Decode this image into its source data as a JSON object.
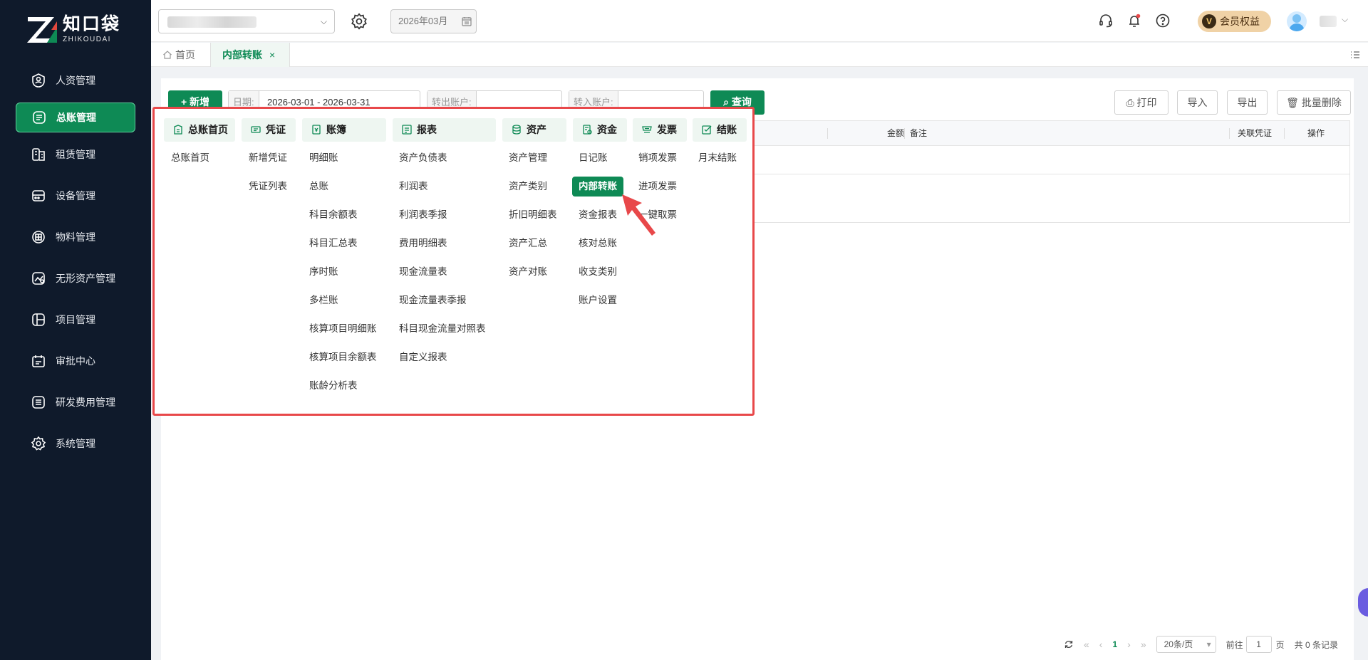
{
  "brand": {
    "name_cn": "知口袋",
    "name_en": "ZHIKOUDAI",
    "accent": "#0e8a55"
  },
  "sidebar": {
    "items": [
      {
        "label": "人资管理",
        "icon": "user-badge-icon"
      },
      {
        "label": "总账管理",
        "icon": "ledger-icon",
        "active": true
      },
      {
        "label": "租赁管理",
        "icon": "lease-icon"
      },
      {
        "label": "设备管理",
        "icon": "device-icon"
      },
      {
        "label": "物料管理",
        "icon": "material-icon"
      },
      {
        "label": "无形资产管理",
        "icon": "intangible-asset-icon"
      },
      {
        "label": "项目管理",
        "icon": "project-icon"
      },
      {
        "label": "审批中心",
        "icon": "approval-icon"
      },
      {
        "label": "研发费用管理",
        "icon": "rd-expense-icon"
      },
      {
        "label": "系统管理",
        "icon": "settings-icon"
      }
    ]
  },
  "header": {
    "period": "2026年03月",
    "vip_badge": "V",
    "vip_label": "会员权益"
  },
  "tabs": {
    "home": "首页",
    "active": "内部转账",
    "close": "×"
  },
  "toolbar": {
    "new_label": "+ 新增",
    "date_label": "日期:",
    "date_value": "2026-03-01 - 2026-03-31",
    "out_account_label": "转出账户:",
    "in_account_label": "转入账户:",
    "query_label": "查询",
    "print_label": "打印",
    "import_label": "导入",
    "export_label": "导出",
    "batch_delete_label": "批量删除"
  },
  "table": {
    "columns": {
      "amount": "金额",
      "remark": "备注",
      "voucher": "关联凭证",
      "action": "操作"
    }
  },
  "pagination": {
    "current_page": "1",
    "page_size": "20条/页",
    "goto_prefix": "前往",
    "goto_value": "1",
    "goto_suffix": "页",
    "total": "共 0 条记录"
  },
  "mega_menu": {
    "columns": [
      {
        "title": "总账首页",
        "icon": "home-ledger-icon",
        "links": [
          "总账首页"
        ]
      },
      {
        "title": "凭证",
        "icon": "voucher-icon",
        "links": [
          "新增凭证",
          "凭证列表"
        ]
      },
      {
        "title": "账簿",
        "icon": "book-icon",
        "links": [
          "明细账",
          "总账",
          "科目余额表",
          "科目汇总表",
          "序时账",
          "多栏账",
          "核算项目明细账",
          "核算项目余额表",
          "账龄分析表"
        ]
      },
      {
        "title": "报表",
        "icon": "report-icon",
        "links": [
          "资产负债表",
          "利润表",
          "利润表季报",
          "费用明细表",
          "现金流量表",
          "现金流量表季报",
          "科目现金流量对照表",
          "自定义报表"
        ]
      },
      {
        "title": "资产",
        "icon": "asset-icon",
        "links": [
          "资产管理",
          "资产类别",
          "折旧明细表",
          "资产汇总",
          "资产对账"
        ]
      },
      {
        "title": "资金",
        "icon": "fund-icon",
        "links": [
          "日记账",
          "内部转账",
          "资金报表",
          "核对总账",
          "收支类别",
          "账户设置"
        ]
      },
      {
        "title": "发票",
        "icon": "invoice-icon",
        "links": [
          "销项发票",
          "进项发票",
          "一键取票"
        ]
      },
      {
        "title": "结账",
        "icon": "close-period-icon",
        "links": [
          "月末结账"
        ]
      }
    ],
    "active_link": "内部转账"
  }
}
